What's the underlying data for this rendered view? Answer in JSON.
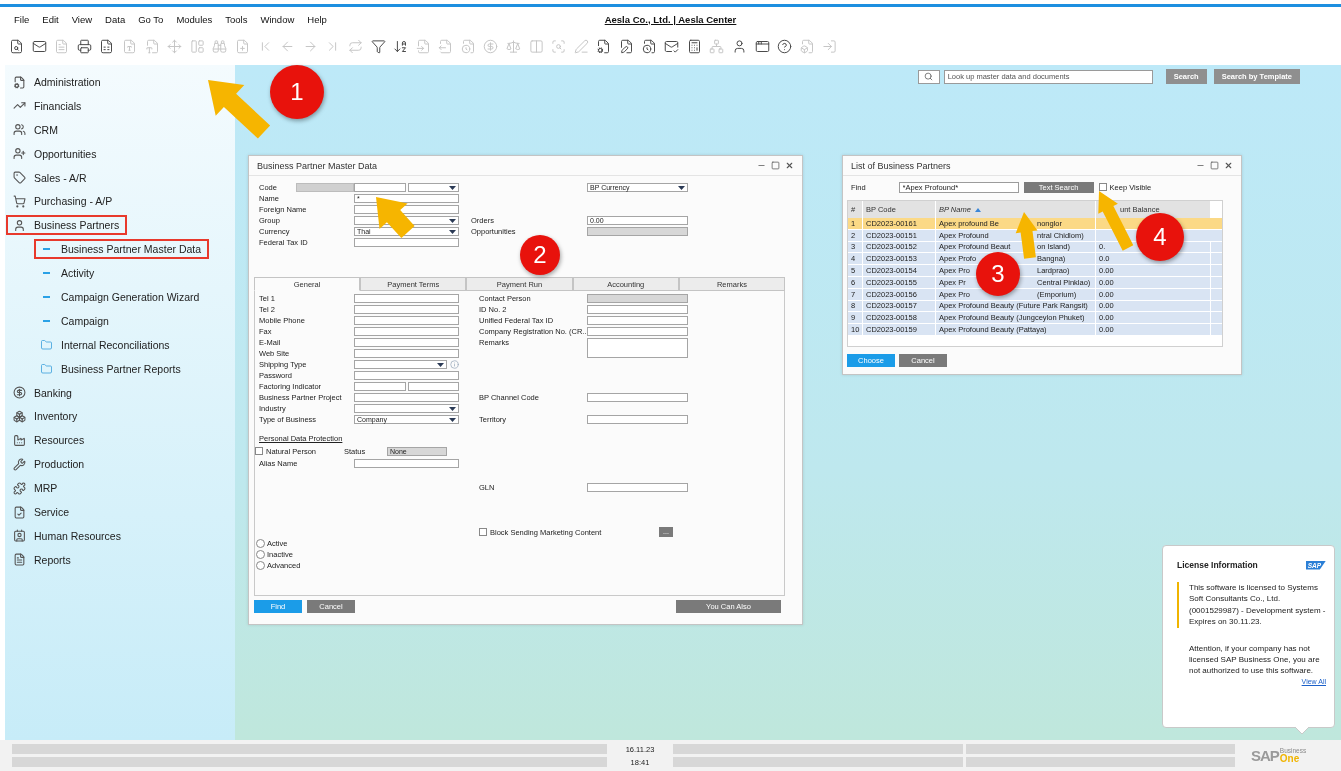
{
  "menu": [
    "File",
    "Edit",
    "View",
    "Data",
    "Go To",
    "Modules",
    "Tools",
    "Window",
    "Help"
  ],
  "company_title": "Aesla Co., Ltd. | Aesla Center",
  "toolbar": [
    {
      "disabled": false
    },
    {
      "disabled": false
    },
    {
      "disabled": true
    },
    {
      "disabled": false
    },
    {
      "disabled": false
    },
    {
      "disabled": true
    },
    {
      "disabled": true
    },
    {
      "disabled": true
    },
    {
      "disabled": true
    },
    {
      "disabled": true
    },
    {
      "disabled": true
    },
    {
      "disabled": true
    },
    {
      "disabled": true
    },
    {
      "disabled": true
    },
    {
      "disabled": true
    },
    {
      "disabled": true
    },
    {
      "disabled": false
    },
    {
      "disabled": false
    },
    {
      "disabled": true
    },
    {
      "disabled": true
    },
    {
      "disabled": true
    },
    {
      "disabled": true
    },
    {
      "disabled": true
    },
    {
      "disabled": true
    },
    {
      "disabled": true
    },
    {
      "disabled": true
    },
    {
      "disabled": false
    },
    {
      "disabled": false
    },
    {
      "disabled": false
    },
    {
      "disabled": false
    },
    {
      "disabled": false
    },
    {
      "disabled": true
    },
    {
      "disabled": false
    },
    {
      "disabled": false
    },
    {
      "disabled": false
    },
    {
      "disabled": true
    },
    {
      "disabled": true
    }
  ],
  "sidebar": {
    "items": [
      {
        "label": "Administration",
        "highlighted": false
      },
      {
        "label": "Financials",
        "highlighted": false
      },
      {
        "label": "CRM",
        "highlighted": false
      },
      {
        "label": "Opportunities",
        "highlighted": false
      },
      {
        "label": "Sales - A/R",
        "highlighted": false
      },
      {
        "label": "Purchasing - A/P",
        "highlighted": false
      },
      {
        "label": "Business Partners",
        "highlighted": true,
        "children": [
          {
            "label": "Business Partner Master Data",
            "kind": "form",
            "highlighted": true
          },
          {
            "label": "Activity",
            "kind": "form",
            "highlighted": false
          },
          {
            "label": "Campaign Generation Wizard",
            "kind": "form",
            "highlighted": false
          },
          {
            "label": "Campaign",
            "kind": "form",
            "highlighted": false
          },
          {
            "label": "Internal Reconciliations",
            "kind": "folder",
            "highlighted": false
          },
          {
            "label": "Business Partner Reports",
            "kind": "folder",
            "highlighted": false
          }
        ]
      },
      {
        "label": "Banking",
        "highlighted": false
      },
      {
        "label": "Inventory",
        "highlighted": false
      },
      {
        "label": "Resources",
        "highlighted": false
      },
      {
        "label": "Production",
        "highlighted": false
      },
      {
        "label": "MRP",
        "highlighted": false
      },
      {
        "label": "Service",
        "highlighted": false
      },
      {
        "label": "Human Resources",
        "highlighted": false
      },
      {
        "label": "Reports",
        "highlighted": false
      }
    ]
  },
  "global_search": {
    "placeholder": "Look up master data and documents",
    "buttons": [
      "Search",
      "Search by Template"
    ]
  },
  "bp_window": {
    "title": "Business Partner Master Data",
    "header_rows": [
      {
        "left": {
          "label": "Code",
          "fields": [
            {
              "kind": "series"
            },
            {
              "kind": "text"
            },
            {
              "kind": "dropdown"
            }
          ]
        },
        "right": {
          "fields": [
            {
              "kind": "dropdown",
              "value": "BP Currency"
            }
          ]
        }
      },
      {
        "left": {
          "label": "Name",
          "fields": [
            {
              "kind": "text",
              "value": "*"
            }
          ]
        }
      },
      {
        "left": {
          "label": "Foreign Name",
          "fields": [
            {
              "kind": "text"
            }
          ]
        }
      },
      {
        "left": {
          "label": "Group",
          "fields": [
            {
              "kind": "dropdown"
            }
          ]
        },
        "right": {
          "label": "Orders",
          "fields": [
            {
              "kind": "text",
              "value": "0.00"
            }
          ]
        }
      },
      {
        "left": {
          "label": "Currency",
          "fields": [
            {
              "kind": "dropdown",
              "value": "Thai"
            }
          ]
        },
        "right": {
          "label": "Opportunities",
          "fields": [
            {
              "kind": "readonly"
            }
          ]
        }
      },
      {
        "left": {
          "label": "Federal Tax ID",
          "fields": [
            {
              "kind": "text"
            }
          ]
        }
      }
    ],
    "tabs": [
      {
        "label": "General",
        "selected": true
      },
      {
        "label": "Payment Terms",
        "selected": false
      },
      {
        "label": "Payment Run",
        "selected": false
      },
      {
        "label": "Accounting",
        "selected": false
      },
      {
        "label": "Remarks",
        "selected": false
      }
    ],
    "general_rows": [
      {
        "left": {
          "label": "Tel 1",
          "fields": [
            {
              "kind": "text"
            }
          ]
        },
        "right": {
          "label": "Contact Person",
          "fields": [
            {
              "kind": "readonly"
            }
          ]
        }
      },
      {
        "left": {
          "label": "Tel 2",
          "fields": [
            {
              "kind": "text"
            }
          ]
        },
        "right": {
          "label": "ID No. 2",
          "fields": [
            {
              "kind": "text"
            }
          ]
        }
      },
      {
        "left": {
          "label": "Mobile Phone",
          "fields": [
            {
              "kind": "text"
            }
          ]
        },
        "right": {
          "label": "Unified Federal Tax ID",
          "fields": [
            {
              "kind": "text"
            }
          ]
        }
      },
      {
        "left": {
          "label": "Fax",
          "fields": [
            {
              "kind": "text"
            }
          ]
        },
        "right": {
          "label": "Company Registration No. (CR...",
          "fields": [
            {
              "kind": "text"
            }
          ]
        }
      },
      {
        "left": {
          "label": "E-Mail",
          "fields": [
            {
              "kind": "text"
            }
          ]
        },
        "right": {
          "label": "Remarks",
          "fields": [
            {
              "kind": "textarea"
            }
          ]
        }
      },
      {
        "left": {
          "label": "Web Site",
          "fields": [
            {
              "kind": "text"
            }
          ]
        }
      },
      {
        "left": {
          "label": "Shipping Type",
          "fields": [
            {
              "kind": "dropdown"
            }
          ],
          "hint_icon": true
        }
      },
      {
        "left": {
          "label": "Password",
          "fields": [
            {
              "kind": "text"
            }
          ]
        }
      },
      {
        "left": {
          "label": "Factoring Indicator",
          "fields": [
            {
              "kind": "text"
            },
            {
              "kind": "text"
            }
          ]
        }
      },
      {
        "left": {
          "label": "Business Partner Project",
          "fields": [
            {
              "kind": "text"
            }
          ]
        },
        "right": {
          "label": "BP Channel Code",
          "fields": [
            {
              "kind": "text"
            }
          ]
        }
      },
      {
        "left": {
          "label": "Industry",
          "fields": [
            {
              "kind": "dropdown"
            }
          ]
        }
      },
      {
        "left": {
          "label": "Type of Business",
          "fields": [
            {
              "kind": "dropdown",
              "value": "Company"
            }
          ]
        },
        "right": {
          "label": "Territory",
          "fields": [
            {
              "kind": "text"
            }
          ]
        }
      }
    ],
    "pdp": {
      "heading": "Personal Data Protection",
      "natural_person": {
        "label": "Natural Person",
        "checked": false
      },
      "status_label": "Status",
      "status_value": "None",
      "alias_label": "Alias Name"
    },
    "gln_label": "GLN",
    "block_marketing": {
      "label": "Block Sending Marketing Content",
      "checked": false,
      "more": "..."
    },
    "status_radios": [
      {
        "label": "Active",
        "selected": false
      },
      {
        "label": "Inactive",
        "selected": false
      },
      {
        "label": "Advanced",
        "selected": false
      }
    ],
    "buttons": [
      {
        "label": "Find",
        "kind": "primary"
      },
      {
        "label": "Cancel",
        "kind": "secondary"
      },
      {
        "label": "You Can Also",
        "kind": "menu"
      }
    ]
  },
  "list_window": {
    "title": "List of Business Partners",
    "find_label": "Find",
    "find_value": "*Apex Profound*",
    "search_button": "Text Search",
    "keep_visible": {
      "label": "Keep Visible",
      "checked": false
    },
    "columns": [
      {
        "label": "#",
        "sorted": false
      },
      {
        "label": "BP Code",
        "sorted": false
      },
      {
        "label": "BP Name",
        "sorted": true
      },
      {
        "label": "unt Balance",
        "sorted": false
      }
    ],
    "rows": [
      {
        "number": "1",
        "code": "CD2023-00161",
        "name": "Apex profound Be",
        "name_tail": "nonglor",
        "selected": true
      },
      {
        "number": "2",
        "code": "CD2023-00151",
        "name": "Apex Profound",
        "name_tail": "ntral Chidlom)",
        "selected": false
      },
      {
        "number": "3",
        "code": "CD2023-00152",
        "name": "Apex Profound Beaut",
        "name_tail": "on Island)",
        "balance": "0.",
        "selected": false
      },
      {
        "number": "4",
        "code": "CD2023-00153",
        "name": "Apex Profo",
        "name_tail": "Bangna)",
        "balance": "0.0",
        "selected": false
      },
      {
        "number": "5",
        "code": "CD2023-00154",
        "name": "Apex Pro",
        "name_tail": "Lardprao)",
        "balance": "0.00",
        "selected": false
      },
      {
        "number": "6",
        "code": "CD2023-00155",
        "name": "Apex Pr",
        "name_tail": "Central Pinklao)",
        "balance": "0.00",
        "selected": false
      },
      {
        "number": "7",
        "code": "CD2023-00156",
        "name": "Apex Pro",
        "name_tail": "(Emporium)",
        "balance": "0.00",
        "selected": false
      },
      {
        "number": "8",
        "code": "CD2023-00157",
        "name": "Apex Profound Beauty (Future Park Rangsit)",
        "balance": "0.00",
        "selected": false
      },
      {
        "number": "9",
        "code": "CD2023-00158",
        "name": "Apex Profound Beauty (Jungceylon Phuket)",
        "balance": "0.00",
        "selected": false
      },
      {
        "number": "10",
        "code": "CD2023-00159",
        "name": "Apex Profound Beauty (Pattaya)",
        "balance": "0.00",
        "selected": false
      }
    ],
    "buttons": [
      {
        "label": "Choose",
        "kind": "primary"
      },
      {
        "label": "Cancel",
        "kind": "secondary"
      }
    ]
  },
  "license": {
    "title": "License Information",
    "badge": "SAP",
    "text": "This software is licensed to Systems Soft Consultants Co., Ltd. (0001529987) - Development system - Expires on 30.11.23.",
    "attention": "Attention, if your company has not licensed SAP Business One, you are not authorized to use this software.",
    "link": "View All"
  },
  "status_bar": {
    "date": "16.11.23",
    "time": "18:41",
    "logo": {
      "brand": "SAP",
      "line1": "Business",
      "line2": "One"
    }
  },
  "callouts": [
    {
      "number": "1"
    },
    {
      "number": "2"
    },
    {
      "number": "3"
    },
    {
      "number": "4"
    }
  ]
}
